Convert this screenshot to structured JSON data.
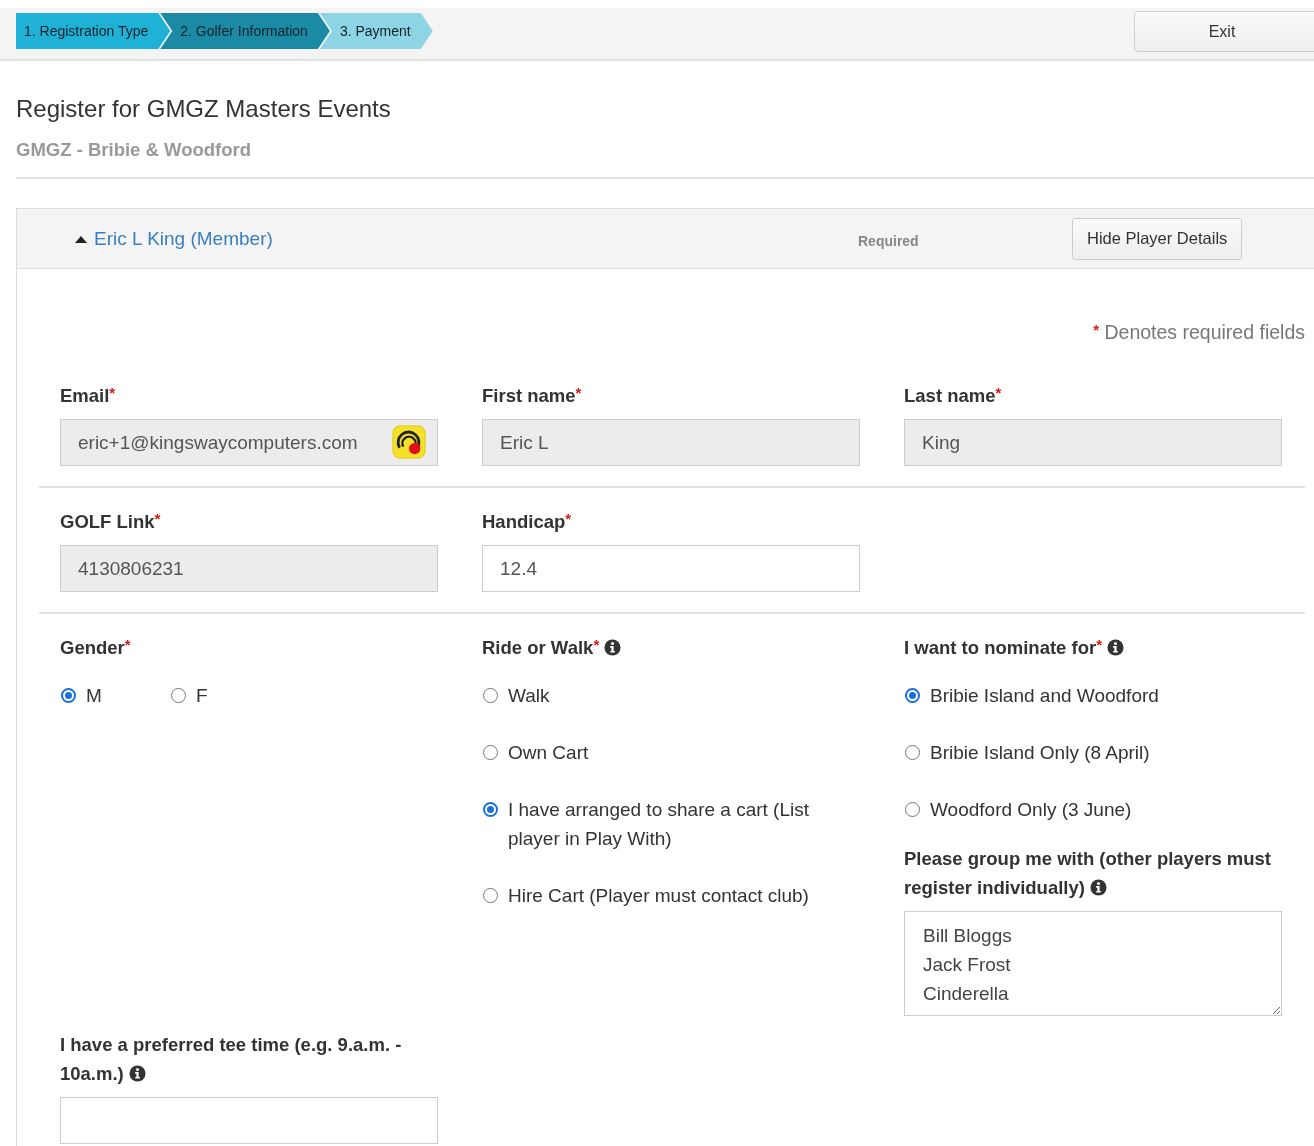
{
  "steps": [
    {
      "label": "1. Registration Type",
      "completed": true,
      "selected": false
    },
    {
      "label": "2. Golfer Information",
      "completed": false,
      "selected": true
    },
    {
      "label": "3. Payment",
      "completed": false,
      "selected": false
    }
  ],
  "exit_button": "Exit",
  "title": "Register for GMGZ Masters Events",
  "subtitle": "GMGZ - Bribie & Woodford",
  "player": {
    "name": "Eric L King",
    "role": "(Member)",
    "expanded": true,
    "required_label": "Required",
    "toggle_button": "Hide Player Details"
  },
  "required_note": {
    "mark": "*",
    "text": "Denotes required fields"
  },
  "sections": [
    [
      [
        [
          {
            "kind": "text",
            "label": "Email",
            "required_mark": "*",
            "value": "eric+1@kingswaycomputers.com",
            "disabled": true,
            "autofill_icon": true
          }
        ],
        [
          {
            "kind": "text",
            "label": "First name",
            "required_mark": "*",
            "value": "Eric L",
            "disabled": true
          }
        ],
        [
          {
            "kind": "text",
            "label": "Last name",
            "required_mark": "*",
            "value": "King",
            "disabled": true
          }
        ]
      ]
    ],
    [
      [
        [
          {
            "kind": "text",
            "label": "GOLF Link",
            "required_mark": "*",
            "value": "4130806231",
            "disabled": true
          }
        ],
        [
          {
            "kind": "text",
            "label": "Handicap",
            "required_mark": "*",
            "value": "12.4",
            "disabled": false
          }
        ]
      ]
    ],
    [
      [
        [
          {
            "kind": "radio",
            "label": "Gender",
            "required_mark": "*",
            "inline": true,
            "options": [
              {
                "label": "M",
                "selected": true
              },
              {
                "label": "F",
                "selected": false
              }
            ]
          }
        ],
        [
          {
            "kind": "radio",
            "label": "Ride or Walk",
            "required_mark": "*",
            "info": true,
            "options": [
              {
                "label": "Walk",
                "selected": false
              },
              {
                "label": "Own Cart",
                "selected": false
              },
              {
                "label": "I have arranged to share a cart (List player in Play With)",
                "selected": true
              },
              {
                "label": "Hire Cart (Player must contact club)",
                "selected": false
              }
            ]
          }
        ],
        [
          {
            "kind": "radio",
            "label": "I want to nominate for",
            "required_mark": "*",
            "info": true,
            "options": [
              {
                "label": "Bribie Island and Woodford",
                "selected": true
              },
              {
                "label": "Bribie Island Only (8 April)",
                "selected": false
              },
              {
                "label": "Woodford Only (3 June)",
                "selected": false
              }
            ]
          },
          {
            "kind": "textarea",
            "label": "Please group me with (other players must register individually)",
            "info": true,
            "value": "Bill Bloggs\nJack Frost\nCinderella"
          }
        ]
      ],
      [
        [
          {
            "kind": "text",
            "label": "I have a preferred tee time (e.g. 9.a.m. - 10a.m.)",
            "info": true,
            "disabled": false
          }
        ]
      ]
    ]
  ]
}
